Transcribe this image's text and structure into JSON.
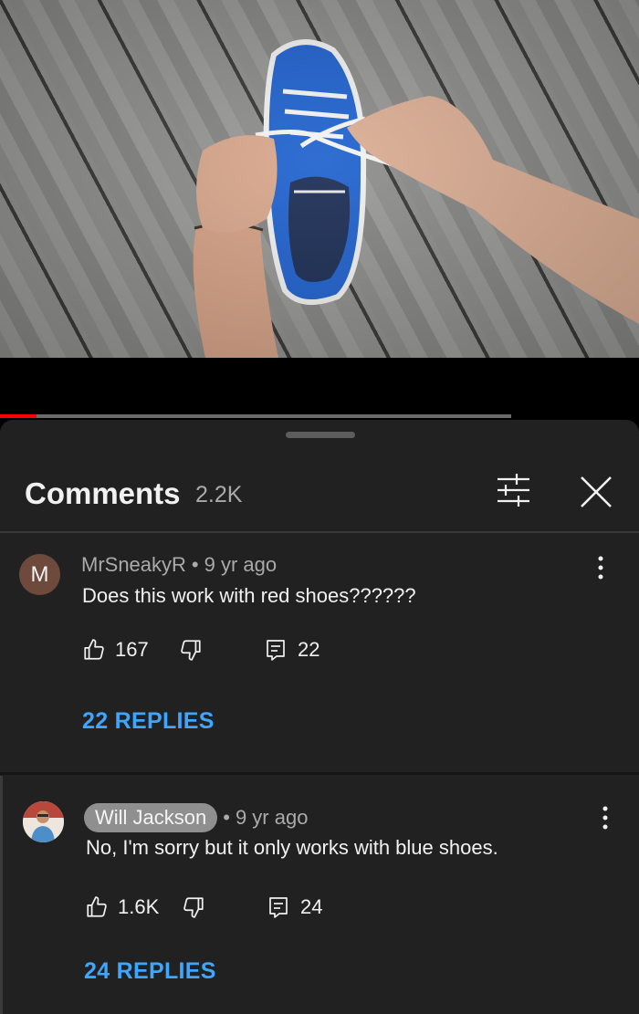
{
  "video": {
    "progress_fraction": 0.057,
    "buffer_fraction": 0.8
  },
  "comments_panel": {
    "title": "Comments",
    "count": "2.2K",
    "filter_icon": "sort-filter-icon",
    "close_icon": "close-icon"
  },
  "comments": [
    {
      "avatar_letter": "M",
      "author": "MrSneakyR",
      "separator": "•",
      "time": "9 yr ago",
      "text": "Does this work with red shoes??????",
      "likes": "167",
      "reply_count": "22",
      "replies_label": "22 REPLIES"
    },
    {
      "avatar_letter": "",
      "author": "Will Jackson",
      "separator": "•",
      "time": "9 yr ago",
      "text": "No, I'm sorry but it only works with blue shoes.",
      "likes": "1.6K",
      "reply_count": "24",
      "replies_label": "24 REPLIES"
    }
  ],
  "colors": {
    "accent_blue": "#3ea6ff",
    "progress_red": "#ff0000",
    "sheet_bg": "#212121"
  }
}
